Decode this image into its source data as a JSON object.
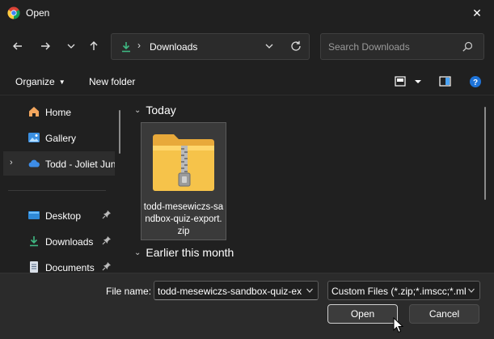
{
  "window": {
    "title": "Open",
    "close_glyph": "✕"
  },
  "nav": {
    "back_glyph": "←",
    "forward_glyph": "→",
    "recent_glyph": "⌄",
    "up_glyph": "↑"
  },
  "address": {
    "separator": "›",
    "location": "Downloads"
  },
  "search": {
    "placeholder": "Search Downloads"
  },
  "toolbar": {
    "organize_label": "Organize",
    "new_folder_label": "New folder"
  },
  "sidebar": {
    "items": [
      {
        "label": "Home",
        "icon": "home-icon"
      },
      {
        "label": "Gallery",
        "icon": "gallery-icon"
      },
      {
        "label": "Todd - Joliet Jun",
        "icon": "onedrive-cloud-icon",
        "chevron": "›"
      },
      {
        "label": "Desktop",
        "icon": "desktop-icon",
        "pinned": true
      },
      {
        "label": "Downloads",
        "icon": "download-icon",
        "pinned": true
      },
      {
        "label": "Documents",
        "icon": "documents-icon",
        "pinned": true
      }
    ]
  },
  "content": {
    "groups": [
      {
        "label": "Today",
        "chevron": "⌄"
      },
      {
        "label": "Earlier this month",
        "chevron": "⌄"
      }
    ],
    "file": {
      "name": "todd-mesewiczs-sandbox-quiz-export.zip",
      "icon": "zip-folder-icon"
    }
  },
  "bottom": {
    "file_name_label": "File name:",
    "file_name_value": "todd-mesewiczs-sandbox-quiz-ex",
    "filter_value": "Custom Files (*.zip;*.imscc;*.ml",
    "open_label": "Open",
    "cancel_label": "Cancel"
  },
  "colors": {
    "background": "#202020",
    "panel": "#2b2b2b",
    "accent_green": "#3fb882",
    "folder_yellow": "#f6c34a"
  }
}
